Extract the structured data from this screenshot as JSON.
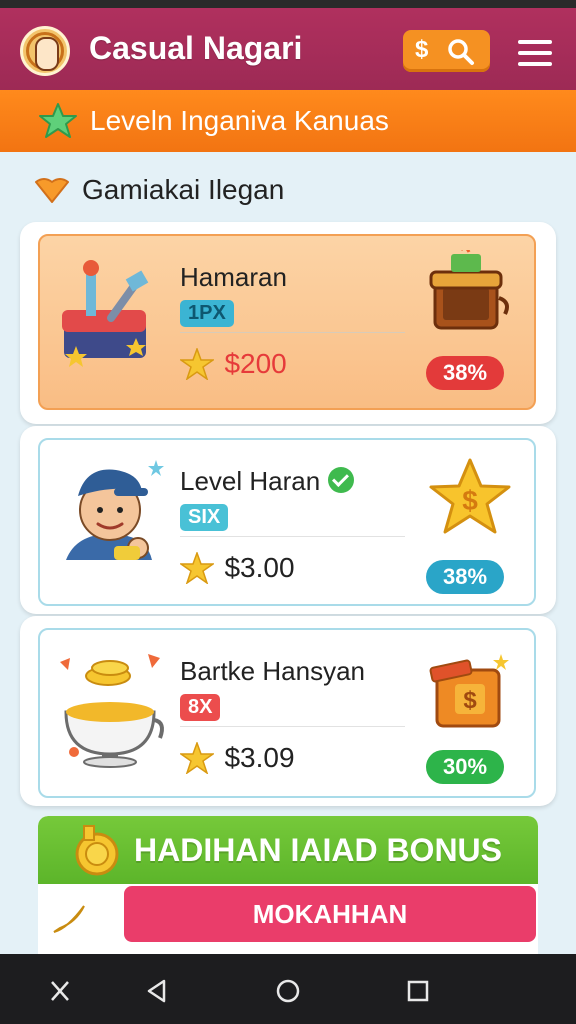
{
  "header": {
    "title": "Casual Nagari",
    "coin_symbol": "$"
  },
  "banner": {
    "text": "Leveln Inganiva Kanuas"
  },
  "section": {
    "title": "Gamiakai Ilegan"
  },
  "cards": [
    {
      "name": "Hamaran",
      "tag": "1PX",
      "price": "$200",
      "percent": "38%",
      "accent": "#e63a3a"
    },
    {
      "name": "Level Haran",
      "tag": "SIX",
      "price": "$3.00",
      "percent": "38%",
      "accent": "#2aa5c8"
    },
    {
      "name": "Bartke Hansyan",
      "tag": "8X",
      "price": "$3.09",
      "percent": "30%",
      "accent": "#2db44a"
    }
  ],
  "bonus": {
    "title": "HADIHAN IAIAD BONUS",
    "button_label": "MOKAHHAN"
  },
  "colors": {
    "header": "#9d2a55",
    "banner": "#f27412",
    "bonus": "#5cb52a",
    "button": "#ea3d6a"
  }
}
